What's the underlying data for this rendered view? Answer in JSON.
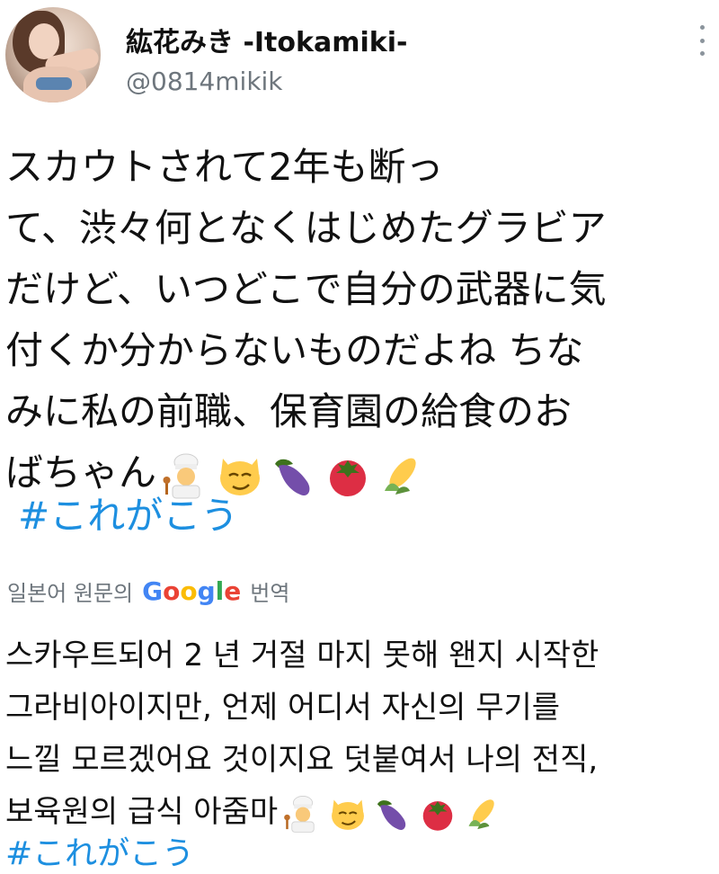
{
  "author": {
    "display_name": "紘花みき -Itokamiki-",
    "handle": "@0814mikik"
  },
  "tweet": {
    "lines": [
      "スカウトされて2年も断っ",
      "て、渋々何となくはじめたグラビア",
      "だけど、いつどこで自分の武器に気",
      "付くか分からないものだよね ちな",
      "みに私の前職、保育園の給食のお",
      "ばちゃん"
    ],
    "emojis": [
      "cook-emoji",
      "smirking-cat-emoji",
      "eggplant-emoji",
      "tomato-emoji",
      "corn-emoji"
    ],
    "hashtag": "#これがこう"
  },
  "translation": {
    "label_prefix": "일본어 원문의",
    "label_brand": "Google",
    "label_suffix": "번역",
    "lines": [
      "스카우트되어 2 년 거절 마지 못해 왠지 시작한",
      "그라비아이지만, 언제 어디서 자신의 무기를",
      "느낄 모르겠어요 것이지요 덧붙여서 나의 전직,",
      "보육원의 급식 아줌마"
    ],
    "hashtag": "#これがこう"
  },
  "colors": {
    "link": "#1d8fe0",
    "secondary_text": "#6e767d"
  }
}
